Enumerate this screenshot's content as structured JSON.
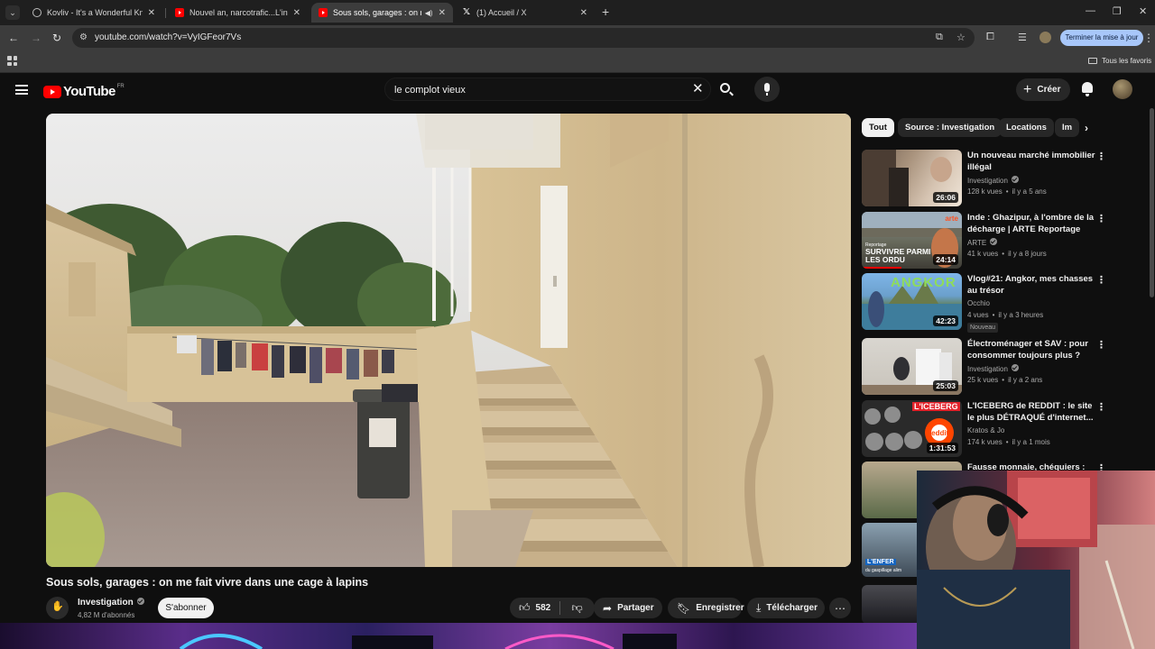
{
  "browser": {
    "tabs": [
      {
        "title": "Kovliv - It's a Wonderful Knife [",
        "icon": "globe-icon",
        "active": false
      },
      {
        "title": "Nouvel an, narcotrafic...L'interv",
        "icon": "youtube-icon",
        "active": false
      },
      {
        "title": "Sous sols, garages : on me",
        "icon": "youtube-icon",
        "active": true,
        "audio": true
      },
      {
        "title": "(1) Accueil / X",
        "icon": "x-icon",
        "active": false
      }
    ],
    "url": "youtube.com/watch?v=VyIGFeor7Vs",
    "update_button": "Terminer la mise à jour",
    "bookmarks_folder": "Tous les favoris"
  },
  "youtube": {
    "logo_text": "YouTube",
    "country_code": "FR",
    "search_query": "le complot vieux",
    "create_label": "Créer"
  },
  "video": {
    "title": "Sous sols, garages : on me fait vivre dans une cage à lapins",
    "channel": "Investigation",
    "subscribers": "4,82 M d'abonnés",
    "subscribe_label": "S'abonner",
    "likes": "582",
    "share_label": "Partager",
    "save_label": "Enregistrer",
    "download_label": "Télécharger"
  },
  "filter_chips": [
    "Tout",
    "Source : Investigation",
    "Locations",
    "Im"
  ],
  "recommendations": [
    {
      "title": "Un nouveau marché immobilier illégal",
      "channel": "Investigation",
      "verified": true,
      "views": "128 k vues",
      "age": "il y a 5 ans",
      "duration": "26:06",
      "badge": ""
    },
    {
      "title": "Inde : Ghazipur, à l'ombre de la décharge | ARTE Reportage",
      "channel": "ARTE",
      "verified": true,
      "views": "41 k vues",
      "age": "il y a 8 jours",
      "duration": "24:14",
      "badge": "",
      "thumb_text": "SURVIVRE PARMI LES ORDU",
      "thumb_small": "Reportage",
      "thumb_logo": "arte"
    },
    {
      "title": "Vlog#21: Angkor, mes chasses au trésor",
      "channel": "Occhio",
      "verified": false,
      "views": "4 vues",
      "age": "il y a 3 heures",
      "duration": "42:23",
      "badge": "Nouveau",
      "thumb_text": "ANGKOR"
    },
    {
      "title": "Électroménager et SAV : pour consommer toujours plus ?",
      "channel": "Investigation",
      "verified": true,
      "views": "25 k vues",
      "age": "il y a 2 ans",
      "duration": "25:03",
      "badge": ""
    },
    {
      "title": "L'ICEBERG de REDDIT : le site le plus DÉTRAQUÉ d'internet...",
      "channel": "Kratos & Jo",
      "verified": false,
      "views": "174 k vues",
      "age": "il y a 1 mois",
      "duration": "1:31:53",
      "badge": "",
      "thumb_text": "L'ICEBERG",
      "thumb_logo": "reddit"
    },
    {
      "title": "Fausse monnaie, chéquiers :",
      "channel": "",
      "verified": false,
      "views": "",
      "age": "",
      "duration": "",
      "badge": "",
      "thumb_text": "L'ENFER",
      "thumb_small": "du gaspillage alim"
    }
  ]
}
